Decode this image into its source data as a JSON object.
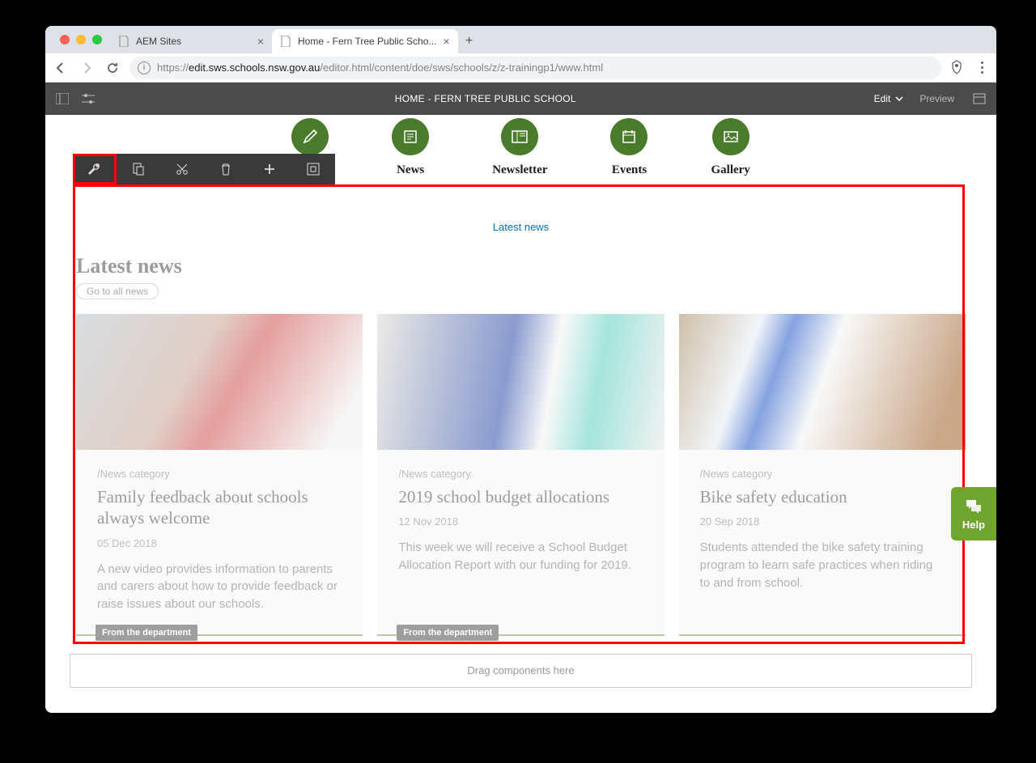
{
  "browser": {
    "tabs": [
      {
        "title": "AEM Sites",
        "active": false
      },
      {
        "title": "Home - Fern Tree Public Scho...",
        "active": true
      }
    ],
    "url_prefix": "https://",
    "url_host": "edit.sws.schools.nsw.gov.au",
    "url_path": "/editor.html/content/doe/sws/schools/z/z-trainingp1/www.html"
  },
  "aem": {
    "title": "HOME - FERN TREE PUBLIC SCHOOL",
    "edit": "Edit",
    "preview": "Preview"
  },
  "nav_circles": [
    {
      "icon": "pencil",
      "label": ""
    },
    {
      "icon": "news",
      "label": "News"
    },
    {
      "icon": "newsletter",
      "label": "Newsletter"
    },
    {
      "icon": "calendar",
      "label": "Events"
    },
    {
      "icon": "gallery",
      "label": "Gallery"
    }
  ],
  "component_link": "Latest news",
  "section": {
    "heading": "Latest news",
    "go_all": "Go to all news"
  },
  "cards": [
    {
      "badge": "From the department",
      "category": "/News category",
      "title": "Family feedback about schools always welcome",
      "date": "05 Dec 2018",
      "excerpt": "A new video provides information to parents and carers about how to provide feedback or raise issues about our schools."
    },
    {
      "badge": "From the department",
      "category": "/News category",
      "title": "2019 school budget allocations",
      "date": "12 Nov 2018",
      "excerpt": "This week we will receive a School Budget Allocation Report with our funding for 2019."
    },
    {
      "badge": "",
      "category": "/News category",
      "title": "Bike safety education",
      "date": "20 Sep 2018",
      "excerpt": "Students attended the bike safety training program to learn safe practices when riding to and from school."
    }
  ],
  "drop_zone": "Drag components here",
  "help": "Help"
}
